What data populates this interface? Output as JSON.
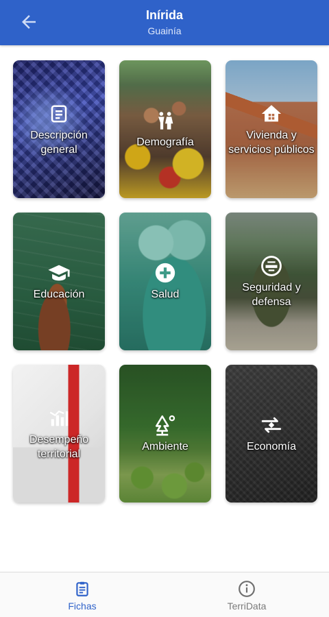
{
  "header": {
    "title": "Inírida",
    "subtitle": "Guainía",
    "back_icon": "arrow-back-icon"
  },
  "cards": [
    {
      "label": "Descripción general",
      "icon": "document-list-icon"
    },
    {
      "label": "Demografía",
      "icon": "people-icon"
    },
    {
      "label": "Vivienda y servicios públicos",
      "icon": "house-icon"
    },
    {
      "label": "Educación",
      "icon": "graduation-cap-icon"
    },
    {
      "label": "Salud",
      "icon": "health-cross-icon"
    },
    {
      "label": "Seguridad y defensa",
      "icon": "shield-emblem-icon"
    },
    {
      "label": "Desempeño territorial",
      "icon": "bar-chart-icon"
    },
    {
      "label": "Ambiente",
      "icon": "tree-sun-icon"
    },
    {
      "label": "Economía",
      "icon": "exchange-arrows-icon"
    }
  ],
  "bottom_nav": {
    "items": [
      {
        "label": "Fichas",
        "icon": "clipboard-icon",
        "active": true
      },
      {
        "label": "TerriData",
        "icon": "info-icon",
        "active": false
      }
    ]
  },
  "colors": {
    "primary": "#2f62c9",
    "inactive": "#7a7a7a"
  }
}
